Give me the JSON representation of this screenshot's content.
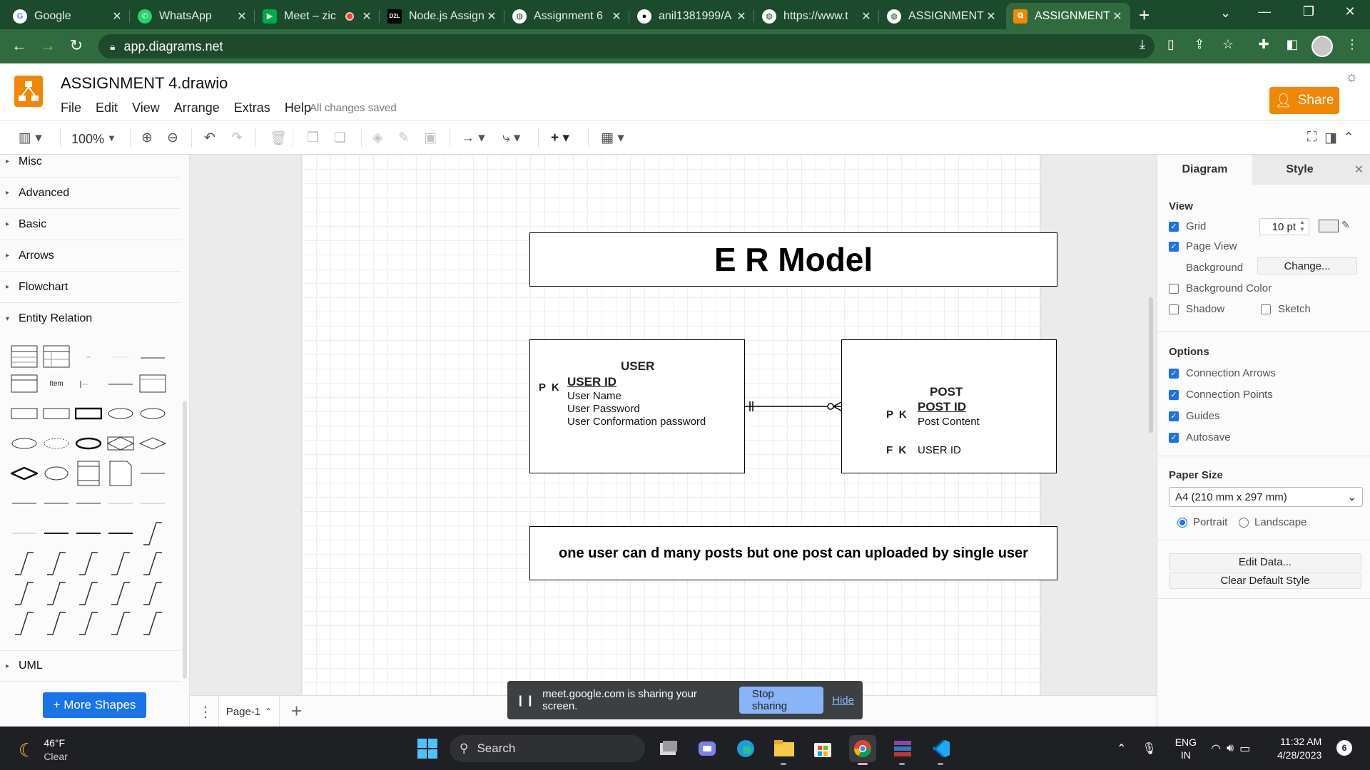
{
  "browser": {
    "tabs": [
      {
        "title": "Google",
        "icon": "google-icon",
        "color": "#ffffff"
      },
      {
        "title": "WhatsApp",
        "icon": "whatsapp-icon",
        "color": "#25d366"
      },
      {
        "title": "Meet – zic",
        "icon": "google-meet-icon",
        "color": "#00ac47"
      },
      {
        "title": "Node.js Assign",
        "icon": "d2l-icon",
        "color": "#000000",
        "favicon_text": "D2L"
      },
      {
        "title": "Assignment 6",
        "icon": "globe-icon",
        "color": "#ffffff"
      },
      {
        "title": "anil1381999/A",
        "icon": "github-icon",
        "color": "#ffffff"
      },
      {
        "title": "https://www.t",
        "icon": "globe-icon",
        "color": "#ffffff"
      },
      {
        "title": "ASSIGNMENT",
        "icon": "globe-icon",
        "color": "#ffffff"
      },
      {
        "title": "ASSIGNMENT",
        "icon": "drawio-icon",
        "color": "#f08705",
        "active": true
      }
    ],
    "url": "app.diagrams.net"
  },
  "app": {
    "doc_title": "ASSIGNMENT 4.drawio",
    "menus": [
      "File",
      "Edit",
      "View",
      "Arrange",
      "Extras",
      "Help"
    ],
    "saved_status": "All changes saved",
    "share_label": "Share",
    "accent": "#f08705"
  },
  "toolbar": {
    "zoom": "100%"
  },
  "sidebar": {
    "sections": [
      "Misc",
      "Advanced",
      "Basic",
      "Arrows",
      "Flowchart",
      "Entity Relation"
    ],
    "expanded_section": "Entity Relation",
    "bottom_section": "UML",
    "item_label": "Item",
    "more_shapes": "+ More Shapes"
  },
  "diagram": {
    "title": "E R Model",
    "user": {
      "name": "USER",
      "pk_label": "P K",
      "pk": "USER ID",
      "attributes": [
        "User Name",
        "User Password",
        "User Conformation password"
      ]
    },
    "post": {
      "name": "POST",
      "pk_label": "P K",
      "pk": "POST ID",
      "attributes": [
        "Post Content"
      ],
      "fk_label": "F K",
      "fk": "USER ID"
    },
    "note": "one user can d many posts but one post can uploaded by single user"
  },
  "format_panel": {
    "tabs": [
      "Diagram",
      "Style"
    ],
    "view_heading": "View",
    "grid_label": "Grid",
    "grid_size": "10 pt",
    "page_view_label": "Page View",
    "background_label": "Background",
    "change_label": "Change...",
    "background_color_label": "Background Color",
    "shadow_label": "Shadow",
    "sketch_label": "Sketch",
    "options_heading": "Options",
    "options": [
      {
        "label": "Connection Arrows",
        "checked": true
      },
      {
        "label": "Connection Points",
        "checked": true
      },
      {
        "label": "Guides",
        "checked": true
      },
      {
        "label": "Autosave",
        "checked": true
      }
    ],
    "paper_size_heading": "Paper Size",
    "paper_size": "A4 (210 mm x 297 mm)",
    "portrait_label": "Portrait",
    "landscape_label": "Landscape",
    "orientation": "Portrait",
    "edit_data": "Edit Data...",
    "clear_style": "Clear Default Style"
  },
  "pages": {
    "current": "Page-1"
  },
  "share_banner": {
    "message": "meet.google.com is sharing your screen.",
    "stop": "Stop sharing",
    "hide": "Hide"
  },
  "taskbar": {
    "temperature": "46°F",
    "condition": "Clear",
    "search": "Search",
    "language": "ENG",
    "region": "IN",
    "time": "11:32 AM",
    "date": "4/28/2023",
    "notifications": "6"
  }
}
